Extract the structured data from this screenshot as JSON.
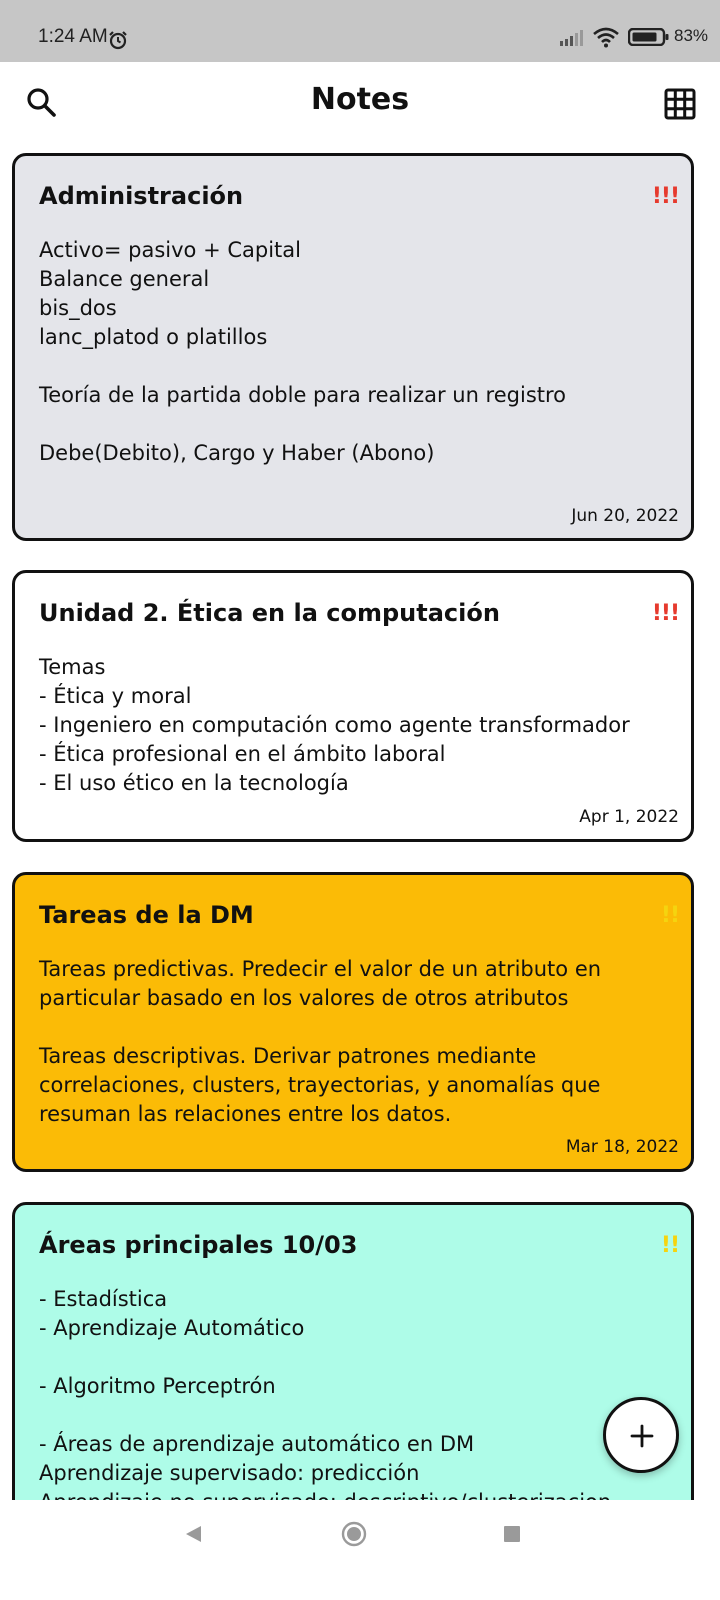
{
  "status_bar": {
    "time": "1:24 AM",
    "battery": "83%"
  },
  "app_bar": {
    "title": "Notes",
    "left_icon": "search-icon",
    "right_icon": "grid-view-icon"
  },
  "colors": {
    "priority_high": "#e63a2e",
    "priority_medium": "#f5d40f",
    "card_gray": "#e4e5ea",
    "card_white": "#ffffff",
    "card_amber": "#fbbb06",
    "card_mint": "#aefce8"
  },
  "notes": [
    {
      "title": "Administración",
      "priority": "!!!",
      "body": "Activo= pasivo + Capital\nBalance general\nbis_dos\nlanc_platod o platillos\n\nTeoría de la partida doble para realizar un registro\n\nDebe(Debito), Cargo y Haber (Abono)",
      "date": "Jun 20, 2022"
    },
    {
      "title": "Unidad 2. Ética en la computación",
      "priority": "!!!",
      "body": "Temas\n- Ética y moral\n- Ingeniero en computación como agente transformador\n- Ética profesional en el ámbito laboral\n- El uso ético en la tecnología",
      "date": "Apr 1, 2022"
    },
    {
      "title": "Tareas de la DM",
      "priority": "!!",
      "body": "Tareas predictivas. Predecir el valor de un atributo en particular basado en los valores de otros atributos\n\nTareas descriptivas. Derivar patrones mediante correlaciones, clusters, trayectorias, y anomalías que resuman las relaciones entre los datos.",
      "date": "Mar 18, 2022"
    },
    {
      "title": "Áreas principales 10/03",
      "priority": "!!",
      "body": "- Estadística\n- Aprendizaje Automático\n\n- Algoritmo Perceptrón\n\n- Áreas de aprendizaje automático en DM\n Aprendizaje supervisado: predicción\n Aprendizaje no supervisado: descriptivo/clusterizacion",
      "date": ""
    }
  ],
  "fab": {
    "icon": "plus-icon"
  },
  "nav_bar": {
    "back_icon": "back-icon",
    "home_icon": "home-icon",
    "recents_icon": "recents-icon"
  }
}
